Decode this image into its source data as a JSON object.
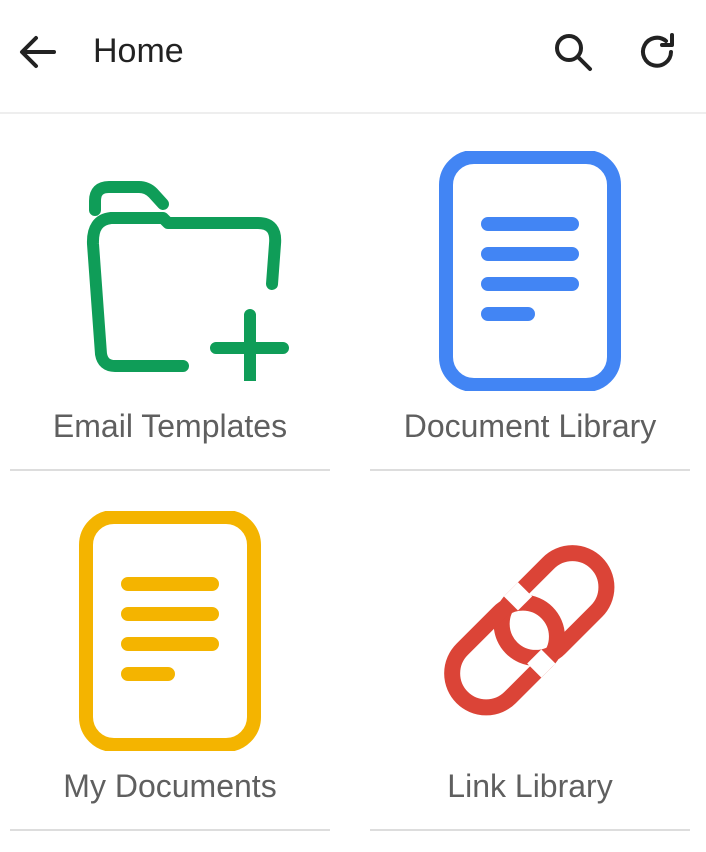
{
  "header": {
    "title": "Home",
    "back_icon": "arrow-back-icon",
    "search_icon": "search-icon",
    "refresh_icon": "refresh-icon"
  },
  "tiles": [
    {
      "label": "Email Templates",
      "icon": "folder-add-icon",
      "color": "#0f9d58"
    },
    {
      "label": "Document Library",
      "icon": "document-icon",
      "color": "#4285f4"
    },
    {
      "label": "My Documents",
      "icon": "document-icon",
      "color": "#f4b400"
    },
    {
      "label": "Link Library",
      "icon": "link-icon",
      "color": "#db4437"
    }
  ]
}
